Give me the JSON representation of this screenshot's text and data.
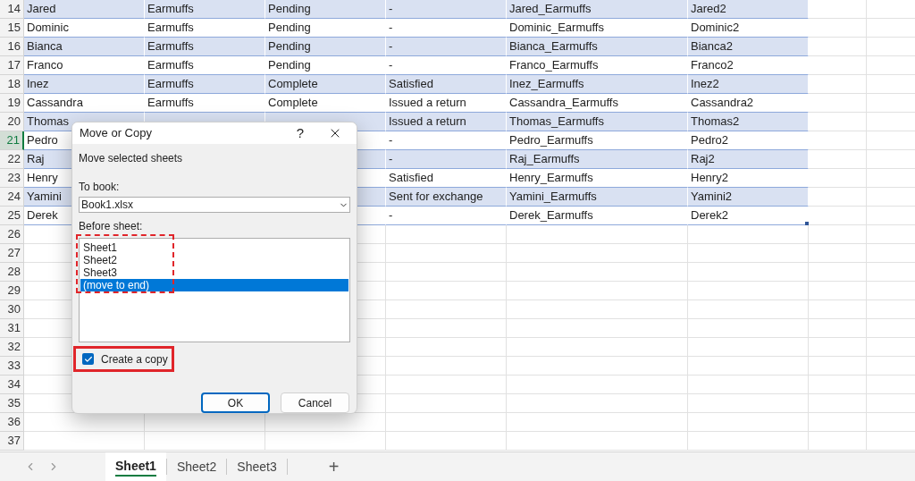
{
  "sheet": {
    "rows": [
      {
        "number": "14",
        "selected": false,
        "cells": {
          "column_1": "Jared",
          "column_2": "Earmuffs",
          "column_3": "Pending",
          "column_4": "-",
          "column_5": "Jared_Earmuffs",
          "column_6": "Jared2"
        }
      },
      {
        "number": "15",
        "selected": false,
        "cells": {
          "column_1": "Dominic",
          "column_2": "Earmuffs",
          "column_3": "Pending",
          "column_4": "-",
          "column_5": "Dominic_Earmuffs",
          "column_6": "Dominic2"
        }
      },
      {
        "number": "16",
        "selected": false,
        "cells": {
          "column_1": "Bianca",
          "column_2": "Earmuffs",
          "column_3": "Pending",
          "column_4": "-",
          "column_5": "Bianca_Earmuffs",
          "column_6": "Bianca2"
        }
      },
      {
        "number": "17",
        "selected": false,
        "cells": {
          "column_1": "Franco",
          "column_2": "Earmuffs",
          "column_3": "Pending",
          "column_4": "-",
          "column_5": "Franco_Earmuffs",
          "column_6": "Franco2"
        }
      },
      {
        "number": "18",
        "selected": false,
        "cells": {
          "column_1": "Inez",
          "column_2": "Earmuffs",
          "column_3": "Complete",
          "column_4": "Satisfied",
          "column_5": "Inez_Earmuffs",
          "column_6": "Inez2"
        }
      },
      {
        "number": "19",
        "selected": false,
        "cells": {
          "column_1": "Cassandra",
          "column_2": "Earmuffs",
          "column_3": "Complete",
          "column_4": "Issued a return",
          "column_5": "Cassandra_Earmuffs",
          "column_6": "Cassandra2"
        }
      },
      {
        "number": "20",
        "selected": false,
        "cells": {
          "column_1": "Thomas",
          "column_4": "Issued a return",
          "column_5": "Thomas_Earmuffs",
          "column_6": "Thomas2"
        }
      },
      {
        "number": "21",
        "selected": true,
        "cells": {
          "column_1": "Pedro",
          "column_4": "-",
          "column_5": "Pedro_Earmuffs",
          "column_6": "Pedro2"
        }
      },
      {
        "number": "22",
        "selected": false,
        "cells": {
          "column_1": "Raj",
          "column_4": "-",
          "column_5": "Raj_Earmuffs",
          "column_6": "Raj2"
        }
      },
      {
        "number": "23",
        "selected": false,
        "cells": {
          "column_1": "Henry",
          "column_4": "Satisfied",
          "column_5": "Henry_Earmuffs",
          "column_6": "Henry2"
        }
      },
      {
        "number": "24",
        "selected": false,
        "cells": {
          "column_1": "Yamini",
          "column_4": "Sent for exchange",
          "column_5": "Yamini_Earmuffs",
          "column_6": "Yamini2"
        }
      },
      {
        "number": "25",
        "selected": false,
        "cells": {
          "column_1": "Derek",
          "column_4": "-",
          "column_5": "Derek_Earmuffs",
          "column_6": "Derek2"
        }
      },
      {
        "number": "26",
        "selected": false
      },
      {
        "number": "27",
        "selected": false
      },
      {
        "number": "28",
        "selected": false
      },
      {
        "number": "29",
        "selected": false
      },
      {
        "number": "30",
        "selected": false
      },
      {
        "number": "31",
        "selected": false
      },
      {
        "number": "32",
        "selected": false
      },
      {
        "number": "33",
        "selected": false
      },
      {
        "number": "34",
        "selected": false
      },
      {
        "number": "35",
        "selected": false
      },
      {
        "number": "36",
        "selected": false
      },
      {
        "number": "37",
        "selected": false
      }
    ]
  },
  "dialog": {
    "title": "Move or Copy",
    "help": "?",
    "instruction": "Move selected sheets",
    "to_book": {
      "label": "To book:",
      "value": "Book1.xlsx"
    },
    "before_sheet": {
      "label": "Before sheet:",
      "items": [
        {
          "label": "Sheet1",
          "selected": false
        },
        {
          "label": "Sheet2",
          "selected": false
        },
        {
          "label": "Sheet3",
          "selected": false
        },
        {
          "label": "(move to end)",
          "selected": true
        }
      ]
    },
    "create_copy": {
      "label": "Create a copy",
      "checked": true
    },
    "buttons": [
      {
        "label": "OK",
        "kind": "default"
      },
      {
        "label": "Cancel",
        "kind": "normal"
      }
    ]
  },
  "sheet_tabs": {
    "tabs": [
      {
        "label": "Sheet1",
        "selected": true
      },
      {
        "label": "Sheet2",
        "selected": false
      },
      {
        "label": "Sheet3",
        "selected": false
      }
    ],
    "add": "+"
  }
}
